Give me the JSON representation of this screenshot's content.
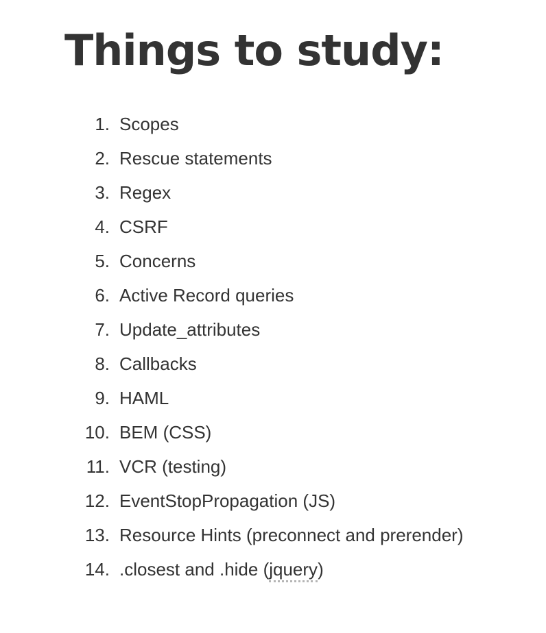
{
  "title": "Things to study:",
  "items": [
    {
      "number": "1.",
      "text": "Scopes"
    },
    {
      "number": "2.",
      "text": "Rescue statements"
    },
    {
      "number": "3.",
      "text": "Regex"
    },
    {
      "number": "4.",
      "text": "CSRF"
    },
    {
      "number": "5.",
      "text": "Concerns"
    },
    {
      "number": "6.",
      "text": "Active Record queries"
    },
    {
      "number": "7.",
      "text": "Update_attributes"
    },
    {
      "number": "8.",
      "text": "Callbacks"
    },
    {
      "number": "9.",
      "text": "HAML"
    },
    {
      "number": "10.",
      "text": "BEM (CSS)"
    },
    {
      "number": "11.",
      "text": "VCR (testing)"
    },
    {
      "number": "12.",
      "text": "EventStopPropagation (JS)"
    },
    {
      "number": "13.",
      "text": "Resource Hints (preconnect and prerender)"
    },
    {
      "number": "14.",
      "text_before": ".closest and .hide (",
      "text_marked": "jquery",
      "text_after": ")"
    }
  ]
}
